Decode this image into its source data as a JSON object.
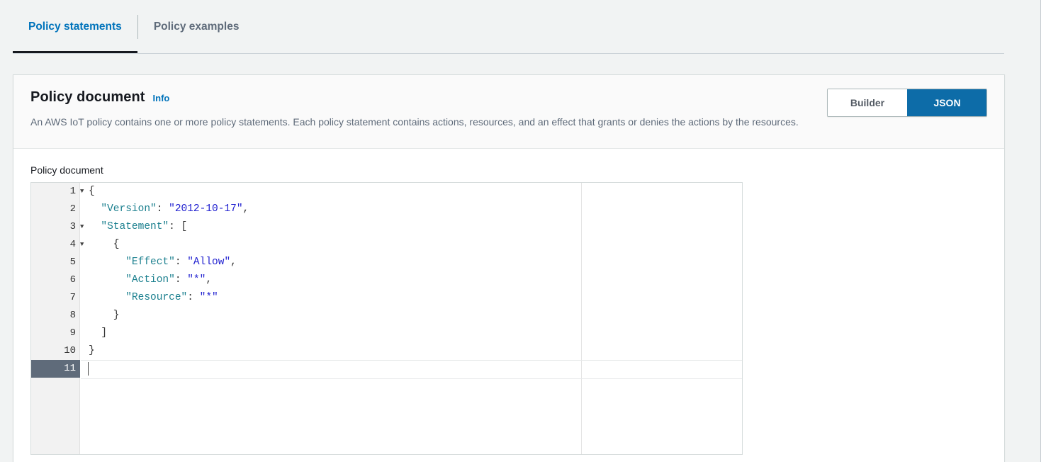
{
  "tabs": [
    {
      "label": "Policy statements",
      "active": true
    },
    {
      "label": "Policy examples",
      "active": false
    }
  ],
  "card": {
    "title": "Policy document",
    "info_label": "Info",
    "description": "An AWS IoT policy contains one or more policy statements. Each policy statement contains actions, resources, and an effect that grants or denies the actions by the resources.",
    "mode_toggle": {
      "builder_label": "Builder",
      "json_label": "JSON",
      "selected": "JSON"
    }
  },
  "editor": {
    "field_label": "Policy document",
    "active_line": 11,
    "total_lines": 11,
    "lines": [
      {
        "num": "1",
        "fold": true,
        "tokens": [
          {
            "t": "{",
            "c": "p"
          }
        ]
      },
      {
        "num": "2",
        "fold": false,
        "tokens": [
          {
            "t": "  \"Version\"",
            "c": "k"
          },
          {
            "t": ": ",
            "c": "p"
          },
          {
            "t": "\"2012-10-17\"",
            "c": "s"
          },
          {
            "t": ",",
            "c": "p"
          }
        ]
      },
      {
        "num": "3",
        "fold": true,
        "tokens": [
          {
            "t": "  \"Statement\"",
            "c": "k"
          },
          {
            "t": ": [",
            "c": "p"
          }
        ]
      },
      {
        "num": "4",
        "fold": true,
        "tokens": [
          {
            "t": "    {",
            "c": "p"
          }
        ]
      },
      {
        "num": "5",
        "fold": false,
        "tokens": [
          {
            "t": "      \"Effect\"",
            "c": "k"
          },
          {
            "t": ": ",
            "c": "p"
          },
          {
            "t": "\"Allow\"",
            "c": "s"
          },
          {
            "t": ",",
            "c": "p"
          }
        ]
      },
      {
        "num": "6",
        "fold": false,
        "tokens": [
          {
            "t": "      \"Action\"",
            "c": "k"
          },
          {
            "t": ": ",
            "c": "p"
          },
          {
            "t": "\"*\"",
            "c": "s"
          },
          {
            "t": ",",
            "c": "p"
          }
        ]
      },
      {
        "num": "7",
        "fold": false,
        "tokens": [
          {
            "t": "      \"Resource\"",
            "c": "k"
          },
          {
            "t": ": ",
            "c": "p"
          },
          {
            "t": "\"*\"",
            "c": "s"
          }
        ]
      },
      {
        "num": "8",
        "fold": false,
        "tokens": [
          {
            "t": "    }",
            "c": "p"
          }
        ]
      },
      {
        "num": "9",
        "fold": false,
        "tokens": [
          {
            "t": "  ]",
            "c": "p"
          }
        ]
      },
      {
        "num": "10",
        "fold": false,
        "tokens": [
          {
            "t": "}",
            "c": "p"
          }
        ]
      },
      {
        "num": "11",
        "fold": false,
        "tokens": []
      }
    ],
    "fold_glyph": "▼"
  },
  "colors": {
    "accent_blue": "#0073bb",
    "selected_blue": "#0d6ca8",
    "page_bg": "#f1f3f3",
    "json_key": "#1a7f8e",
    "json_string": "#2121d0",
    "active_line_gutter": "#5f6b7a",
    "tab_underline": "#16191f"
  }
}
